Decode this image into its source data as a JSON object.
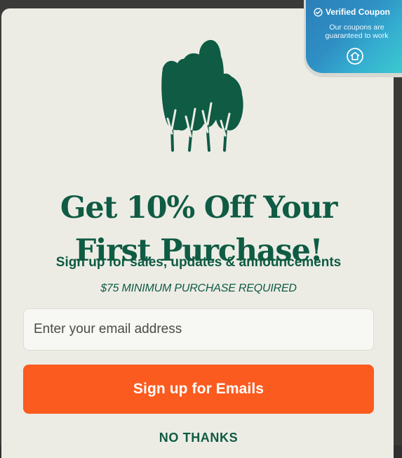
{
  "offer": {
    "headline_line_1": "Get 10% Off Your",
    "headline_line_2": "First Purchase!",
    "subheadline": "Sign up for sales, updates & announcements",
    "minimum_note": "$75 MINIMUM PURCHASE REQUIRED"
  },
  "form": {
    "email_placeholder": "Enter your email address",
    "email_value": "",
    "signup_label": "Sign up for Emails",
    "no_thanks_label": "NO THANKS"
  },
  "verified_badge": {
    "title": "Verified Coupon",
    "line_1": "Our coupons are",
    "line_2": "guaranteed to work"
  },
  "icons": {
    "brand": "trees-icon",
    "verified": "check-circle-icon",
    "badge_home": "home-icon"
  },
  "colors": {
    "background": "#ecece5",
    "brand_green": "#0f5b43",
    "accent_orange": "#fb5b1f",
    "badge_blue": "#2f8fc4",
    "badge_teal": "#3cc9cf"
  }
}
